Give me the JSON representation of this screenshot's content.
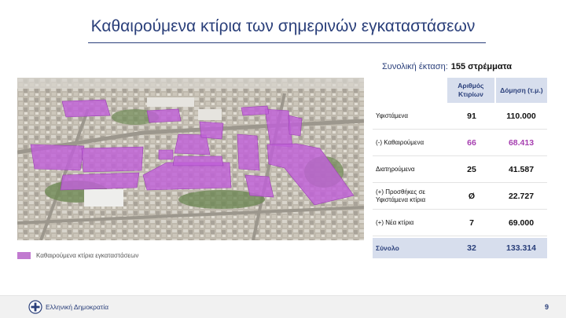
{
  "slide": {
    "title": "Καθαιρούμενα κτίρια των σημερινών εγκαταστάσεων",
    "page_number": "9"
  },
  "summary": {
    "label": "Συνολική έκταση:",
    "value": "155 στρέμματα"
  },
  "table": {
    "headers": [
      "",
      "Αριθμός Κτιρίων",
      "Δόμηση (τ.μ.)"
    ],
    "rows": [
      {
        "label": "Υφιστάμενα",
        "count": "91",
        "area": "110.000",
        "highlight": false
      },
      {
        "label": "(-) Καθαιρούμενα",
        "count": "66",
        "area": "68.413",
        "highlight": true
      },
      {
        "label": "Διατηρούμενα",
        "count": "25",
        "area": "41.587",
        "highlight": false
      },
      {
        "label": "(+) Προσθήκες σε Υφιστάμενα κτίρια",
        "count": "Ø",
        "area": "22.727",
        "highlight": false
      },
      {
        "label": "(+) Νέα κτίρια",
        "count": "7",
        "area": "69.000",
        "highlight": false
      }
    ],
    "total": {
      "label": "Σύνολο",
      "count": "32",
      "area": "133.314"
    }
  },
  "legend": {
    "label": "Καθαιρούμενα κτίρια εγκαταστάσεων",
    "color": "#c17ad0"
  },
  "footer": {
    "organization": "Ελληνική Δημοκρατία",
    "emblem_icon": "greek-emblem-icon"
  },
  "colors": {
    "title": "#2a3f7a",
    "highlight": "#a63fb0",
    "header_fill": "#d7deed",
    "demolished_overlay": "#c060d8"
  }
}
